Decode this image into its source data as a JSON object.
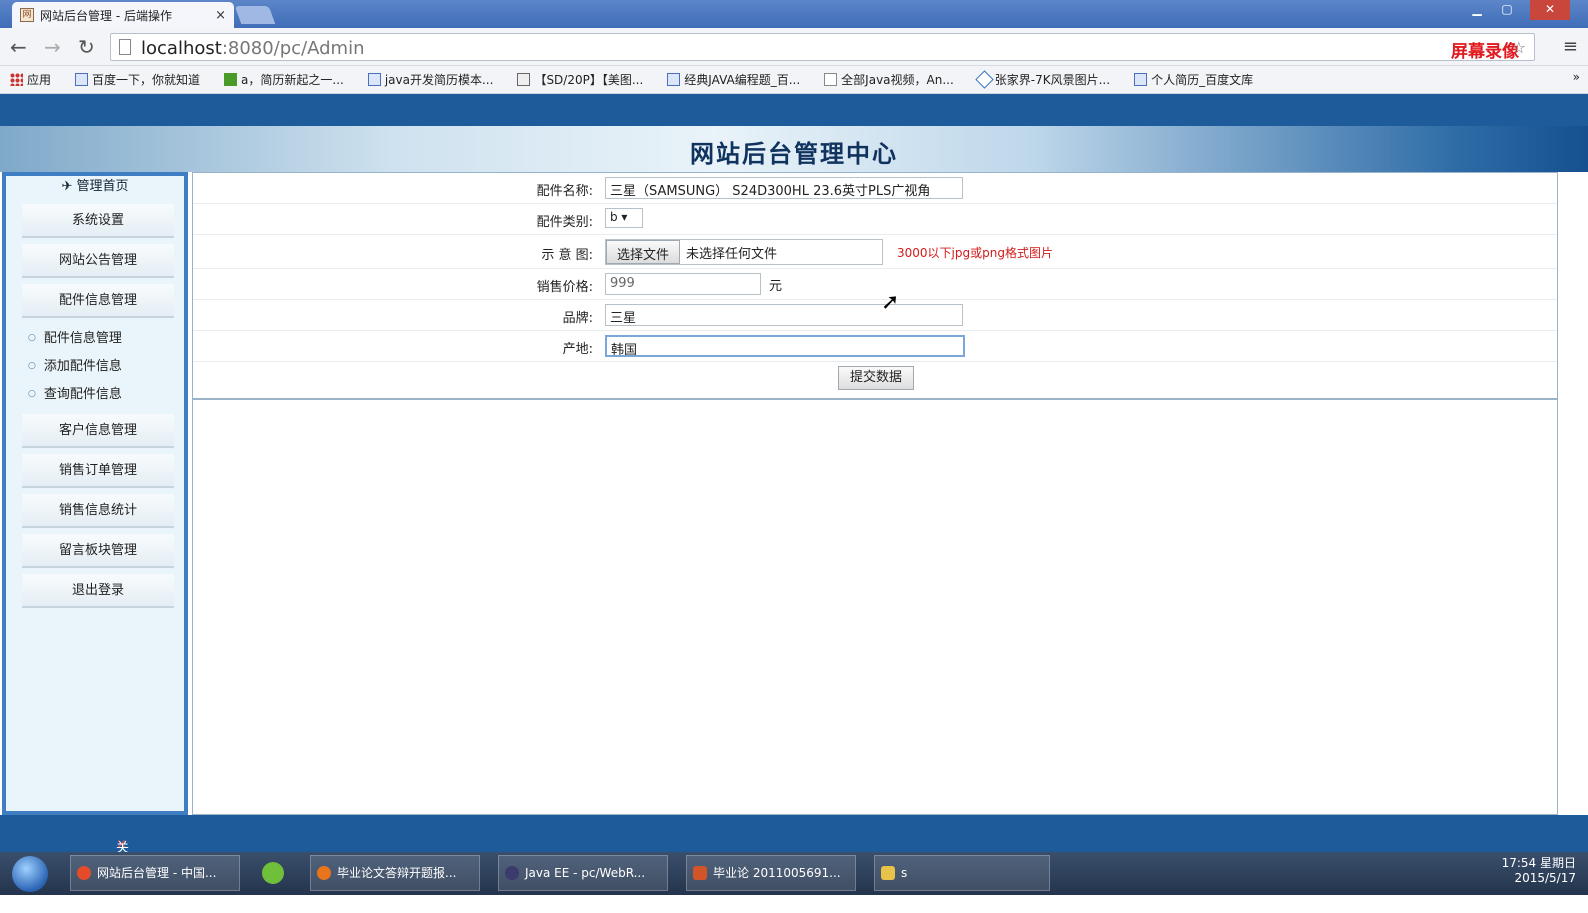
{
  "browser": {
    "tab_title": "网站后台管理 - 后端操作",
    "tab_close": "×",
    "url_host": "localhost",
    "url_rest": ":8080/pc/Admin",
    "watermark": "屏幕录像专家 未注册",
    "bookmarks": [
      "应用",
      "百度一下，你就知道",
      "a，简历新起之一...",
      "java开发简历模本...",
      "【SD/20P】【美图...",
      "经典JAVA编程题_百...",
      "全部Java视频，An...",
      "张家界-7K风景图片...",
      "个人简历_百度文库"
    ],
    "more": "»"
  },
  "admin": {
    "title": "网站后台管理中心",
    "sidebar": {
      "head": "管理首页",
      "items": [
        "系统设置",
        "网站公告管理",
        "配件信息管理"
      ],
      "subitems": [
        "配件信息管理",
        "添加配件信息",
        "查询配件信息"
      ],
      "items2": [
        "客户信息管理",
        "销售订单管理",
        "销售信息统计",
        "留言板块管理",
        "退出登录"
      ]
    },
    "form": {
      "name_label": "配件名称:",
      "name_value": "三星（SAMSUNG） S24D300HL 23.6英寸PLS广视角",
      "category_label": "配件类别:",
      "category_value": "b ▾",
      "image_label": "示 意 图:",
      "file_button": "选择文件",
      "file_status": "未选择任何文件",
      "image_hint": "3000以下jpg或png格式图片",
      "price_label": "销售价格:",
      "price_value": "999",
      "price_unit": "元",
      "brand_label": "品牌:",
      "brand_value": "三星",
      "origin_label": "产地:",
      "origin_value": "韩国",
      "submit": "提交数据"
    },
    "footer": "关闭左栏",
    "footer_x": "×"
  },
  "taskbar": {
    "tasks": [
      "网站后台管理 - 中国...",
      "毕业论文答辩开题报...",
      "Java EE - pc/WebR...",
      "毕业论 2011005691...",
      "s"
    ],
    "time": "17:54 星期日",
    "date": "2015/5/17"
  }
}
